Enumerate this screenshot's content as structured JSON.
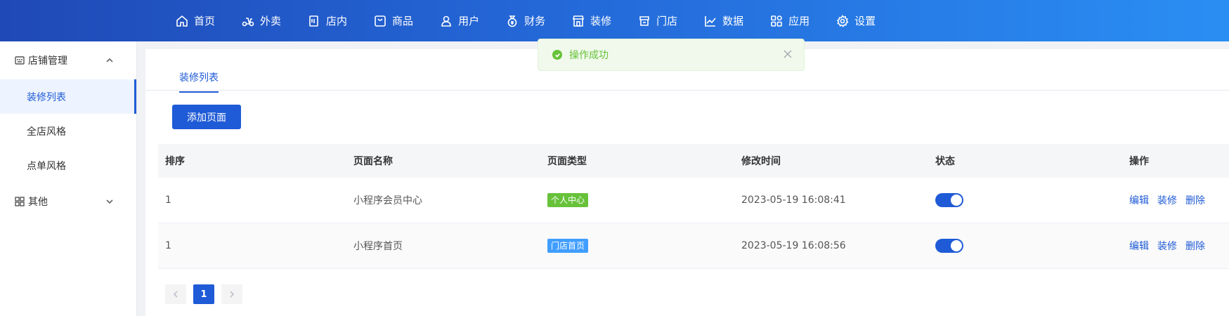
{
  "nav": {
    "items": [
      {
        "label": "首页",
        "icon": "home-icon"
      },
      {
        "label": "外卖",
        "icon": "scooter-icon"
      },
      {
        "label": "店内",
        "icon": "dinein-icon"
      },
      {
        "label": "商品",
        "icon": "product-icon"
      },
      {
        "label": "用户",
        "icon": "user-icon"
      },
      {
        "label": "财务",
        "icon": "money-bag-icon"
      },
      {
        "label": "装修",
        "icon": "storefront-icon"
      },
      {
        "label": "门店",
        "icon": "store-icon"
      },
      {
        "label": "数据",
        "icon": "chart-line-icon"
      },
      {
        "label": "应用",
        "icon": "apps-grid-icon"
      },
      {
        "label": "设置",
        "icon": "gear-icon"
      }
    ]
  },
  "sidebar": {
    "group1": {
      "label": "店铺管理",
      "icon": "shop-icon"
    },
    "items": [
      {
        "label": "装修列表"
      },
      {
        "label": "全店风格"
      },
      {
        "label": "点单风格"
      }
    ],
    "group2": {
      "label": "其他",
      "icon": "apps-grid-icon"
    }
  },
  "tabs": {
    "active": "装修列表"
  },
  "toolbar": {
    "add_label": "添加页面"
  },
  "toast": {
    "message": "操作成功",
    "color": "#67c23a"
  },
  "table": {
    "headers": [
      "排序",
      "页面名称",
      "页面类型",
      "修改时间",
      "状态",
      "操作"
    ],
    "rows": [
      {
        "sort": "1",
        "name": "小程序会员中心",
        "type": "个人中心",
        "type_color": "#67c23a",
        "time": "2023-05-19 16:08:41",
        "status": true
      },
      {
        "sort": "1",
        "name": "小程序首页",
        "type": "门店首页",
        "type_color": "#409eff",
        "time": "2023-05-19 16:08:56",
        "status": true
      }
    ],
    "ops": [
      "编辑",
      "装修",
      "删除"
    ]
  },
  "pager": {
    "current": "1"
  },
  "colors": {
    "primary": "#1f5bd6",
    "success": "#67c23a"
  }
}
